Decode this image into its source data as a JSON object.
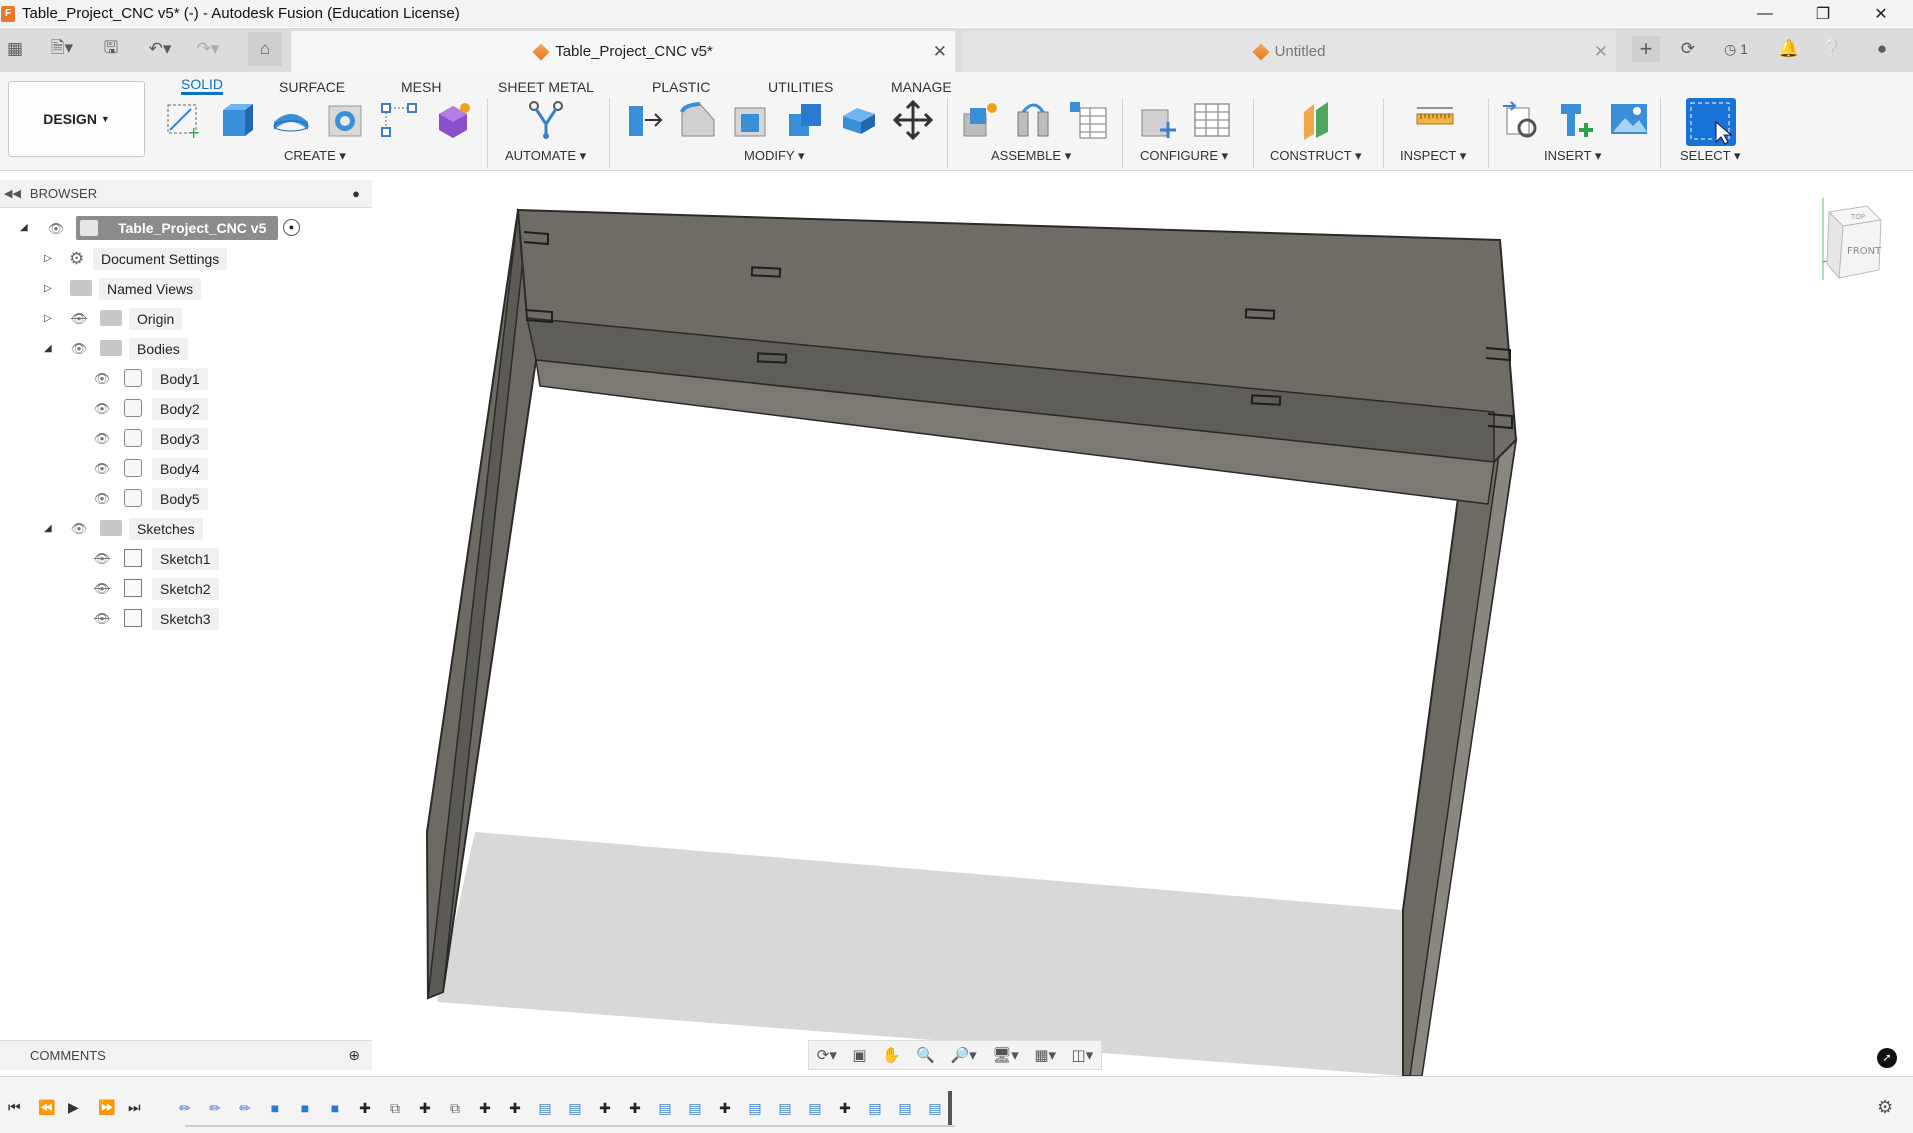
{
  "window": {
    "title": "Table_Project_CNC v5* (-) - Autodesk Fusion (Education License)",
    "app_icon": "F"
  },
  "tabs": [
    {
      "label": "Table_Project_CNC v5*",
      "active": true
    },
    {
      "label": "Untitled",
      "active": false
    }
  ],
  "quick_access": {
    "job_status": "1"
  },
  "workspace": {
    "design_label": "DESIGN"
  },
  "ribbon_tabs": [
    "SOLID",
    "SURFACE",
    "MESH",
    "SHEET METAL",
    "PLASTIC",
    "UTILITIES",
    "MANAGE"
  ],
  "ribbon_groups": {
    "create": "CREATE",
    "automate": "AUTOMATE",
    "modify": "MODIFY",
    "assemble": "ASSEMBLE",
    "configure": "CONFIGURE",
    "construct": "CONSTRUCT",
    "inspect": "INSPECT",
    "insert": "INSERT",
    "select": "SELECT"
  },
  "browser": {
    "title": "BROWSER",
    "root": "Table_Project_CNC v5",
    "document_settings": "Document Settings",
    "named_views": "Named Views",
    "origin": "Origin",
    "bodies_folder": "Bodies",
    "bodies": [
      "Body1",
      "Body2",
      "Body3",
      "Body4",
      "Body5"
    ],
    "sketches_folder": "Sketches",
    "sketches": [
      "Sketch1",
      "Sketch2",
      "Sketch3"
    ]
  },
  "comments": {
    "title": "COMMENTS"
  },
  "viewcube": {
    "top": "TOP",
    "front": "FRONT"
  },
  "colors": {
    "accent": "#0a6fbd",
    "model_fill": "#6e6b65",
    "model_edge": "#2b2a28",
    "shadow": "#d6d6d6"
  }
}
